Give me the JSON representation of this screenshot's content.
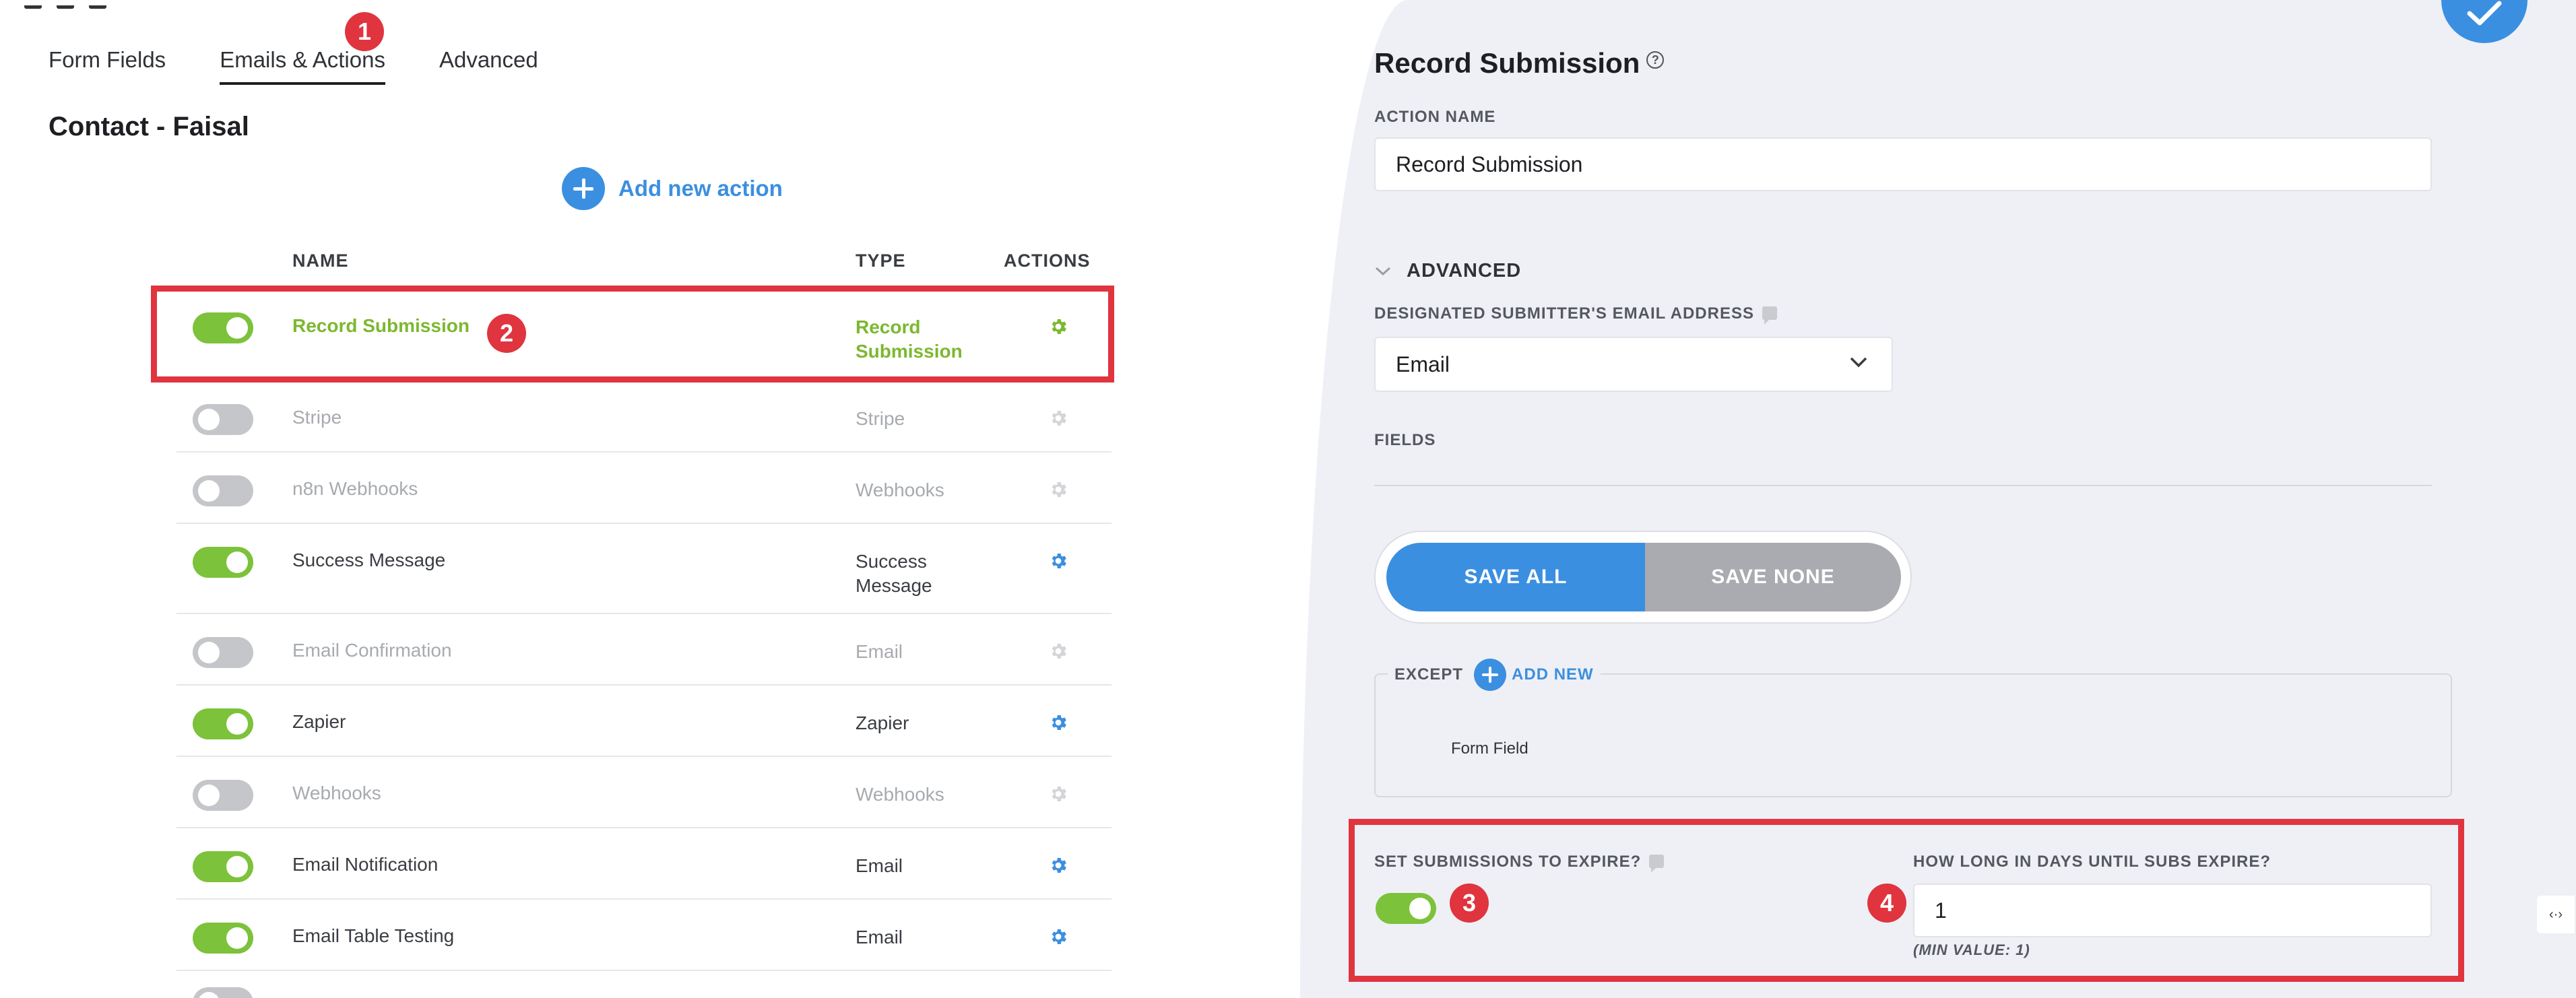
{
  "tabs": [
    {
      "label": "Form Fields"
    },
    {
      "label": "Emails & Actions"
    },
    {
      "label": "Advanced"
    }
  ],
  "form_title": "Contact - Faisal",
  "add_action_label": "Add new action",
  "table": {
    "headers": {
      "name": "NAME",
      "type": "TYPE",
      "actions": "ACTIONS"
    },
    "rows": [
      {
        "name": "Record Submission",
        "type": "Record Submission",
        "enabled": true
      },
      {
        "name": "Stripe",
        "type": "Stripe",
        "enabled": false
      },
      {
        "name": "n8n Webhooks",
        "type": "Webhooks",
        "enabled": false
      },
      {
        "name": "Success Message",
        "type": "Success Message",
        "enabled": true
      },
      {
        "name": "Email Confirmation",
        "type": "Email",
        "enabled": false
      },
      {
        "name": "Zapier",
        "type": "Zapier",
        "enabled": true
      },
      {
        "name": "Webhooks",
        "type": "Webhooks",
        "enabled": false
      },
      {
        "name": "Email Notification",
        "type": "Email",
        "enabled": true
      },
      {
        "name": "Email Table Testing",
        "type": "Email",
        "enabled": true
      }
    ]
  },
  "badges": {
    "b1": "1",
    "b2": "2",
    "b3": "3",
    "b4": "4"
  },
  "panel": {
    "title": "Record Submission",
    "help_glyph": "?",
    "action_name_label": "ACTION NAME",
    "action_name_value": "Record Submission",
    "advanced_label": "ADVANCED",
    "submitter_email_label": "DESIGNATED SUBMITTER'S EMAIL ADDRESS",
    "submitter_email_value": "Email",
    "fields_label": "FIELDS",
    "save_all": "SAVE ALL",
    "save_none": "SAVE NONE",
    "except_label": "EXCEPT",
    "add_new_label": "ADD NEW",
    "form_field_label": "Form Field",
    "expire_label": "SET SUBMISSIONS TO EXPIRE?",
    "expire_enabled": true,
    "days_label": "HOW LONG IN DAYS UNTIL SUBS EXPIRE?",
    "days_value": "1",
    "min_hint": "(MIN VALUE: 1)"
  },
  "side_tool_glyph": "‹·›",
  "colors": {
    "accent_blue": "#3b8fe0",
    "toggle_on": "#7cc23a",
    "highlight_red": "#e0343f",
    "highlight_green_text": "#7cb82f"
  }
}
